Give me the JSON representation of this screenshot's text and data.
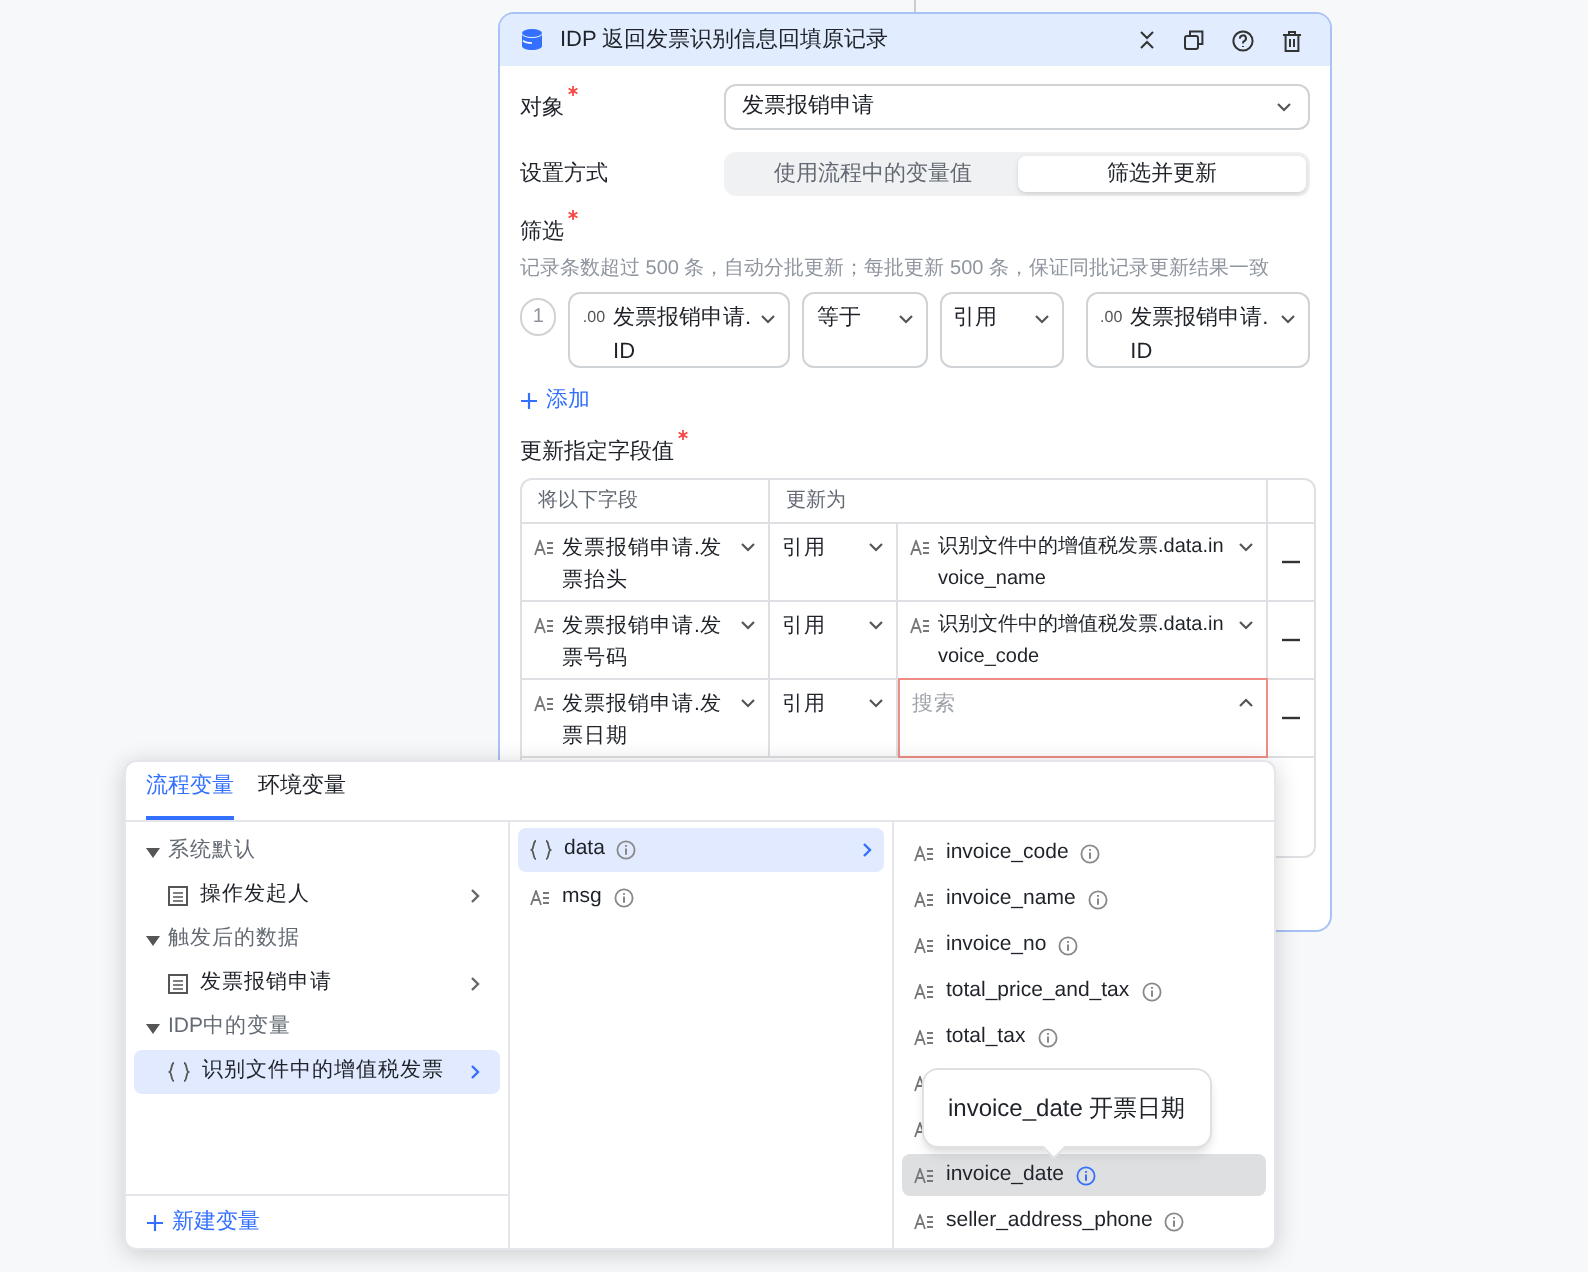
{
  "panel": {
    "title": "IDP 返回发票识别信息回填原记录",
    "object": {
      "label": "对象",
      "required": true,
      "value": "发票报销申请"
    },
    "mode": {
      "label": "设置方式",
      "options": [
        {
          "label": "使用流程中的变量值",
          "selected": false
        },
        {
          "label": "筛选并更新",
          "selected": true
        }
      ]
    },
    "filter": {
      "label": "筛选",
      "required": true,
      "hint": "记录条数超过 500 条，自动分批更新；每批更新 500 条，保证同批记录更新结果一致",
      "conditions": [
        {
          "index": "1",
          "field_tag": ".00",
          "field": "发票报销申请.ID",
          "operator": "等于",
          "value_type": "引用",
          "value_tag": ".00",
          "value": "发票报销申请.ID"
        }
      ],
      "add": "添加"
    },
    "updates": {
      "label": "更新指定字段值",
      "required": true,
      "columns": [
        "将以下字段",
        "更新为"
      ],
      "rows": [
        {
          "field": "发票报销申请.发票抬头",
          "mode": "引用",
          "value": "识别文件中的增值税发票.data.invoice_name",
          "focused": false
        },
        {
          "field": "发票报销申请.发票号码",
          "mode": "引用",
          "value": "识别文件中的增值税发票.data.invoice_code",
          "focused": false
        },
        {
          "field": "发票报销申请.发票日期",
          "mode": "引用",
          "placeholder": "搜索",
          "focused": true
        }
      ]
    }
  },
  "picker": {
    "tabs": [
      {
        "label": "流程变量",
        "selected": true
      },
      {
        "label": "环境变量",
        "selected": false
      }
    ],
    "groups": [
      {
        "label": "系统默认",
        "expanded": true,
        "items": [
          {
            "kind": "table",
            "label": "操作发起人",
            "selected": false
          }
        ]
      },
      {
        "label": "触发后的数据",
        "expanded": true,
        "items": [
          {
            "kind": "table",
            "label": "发票报销申请",
            "selected": false
          }
        ]
      },
      {
        "label": "IDP中的变量",
        "expanded": true,
        "items": [
          {
            "kind": "object",
            "label": "识别文件中的增值税发票",
            "selected": true
          }
        ]
      }
    ],
    "new_variable": "新建变量",
    "children": [
      {
        "kind": "object",
        "label": "data",
        "selected": true
      },
      {
        "kind": "text",
        "label": "msg",
        "selected": false
      }
    ],
    "fields": [
      {
        "kind": "text",
        "label": "invoice_code",
        "hovered": false
      },
      {
        "kind": "text",
        "label": "invoice_name",
        "hovered": false
      },
      {
        "kind": "text",
        "label": "invoice_no",
        "hovered": false
      },
      {
        "kind": "text",
        "label": "total_price_and_tax",
        "hovered": false
      },
      {
        "kind": "text",
        "label": "total_tax",
        "hovered": false
      },
      {
        "kind": "covered"
      },
      {
        "kind": "covered"
      },
      {
        "kind": "text",
        "label": "invoice_date",
        "hovered": true
      },
      {
        "kind": "text",
        "label": "seller_address_phone",
        "hovered": false
      }
    ],
    "tooltip": "invoice_date 开票日期"
  }
}
